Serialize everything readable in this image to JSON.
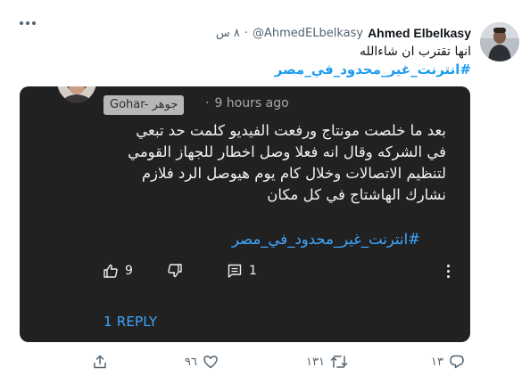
{
  "tweet": {
    "author_name": "Ahmed Elbelkasy",
    "handle": "@AhmedELbelkasy",
    "dot": "·",
    "time": "٨ س",
    "text": "انها تقترب ان شاءالله",
    "hashtag": "#انترنت_غير_محدود_في_مصر"
  },
  "media": {
    "channel_name": "Gohar- جوهر",
    "dot": "·",
    "time_ago": "9 hours ago",
    "comment_lines": [
      "بعد ما خلصت مونتاج ورفعت الفيديو كلمت حد تبعي",
      "في الشركه وقال انه فعلا وصل اخطار للجهاز القومي",
      "لتنظيم الاتصالات وخلال كام يوم هيوصل الرد فلازم",
      "نشارك الهاشتاج في كل مكان"
    ],
    "comment_hashtag": "#انترنت_غير_محدود_في_مصر",
    "like_count": "9",
    "reply_count": "1",
    "reply_link": "1 REPLY"
  },
  "footer": {
    "replies": "١٣",
    "retweets": "١٣١",
    "likes": "٩٦"
  }
}
